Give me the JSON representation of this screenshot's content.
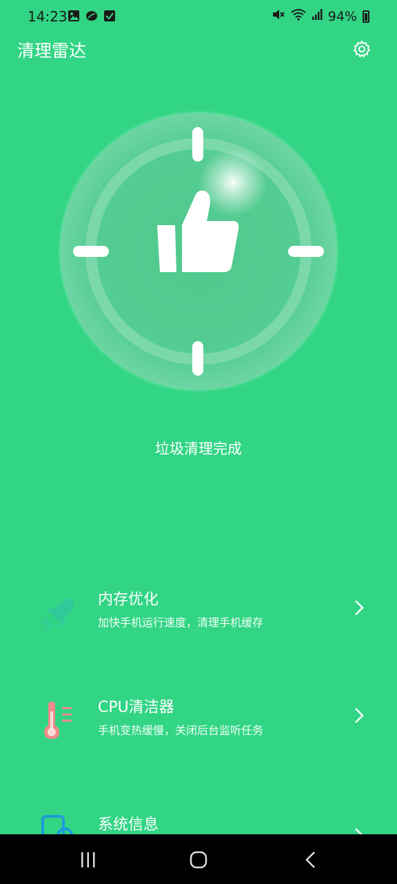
{
  "status_bar": {
    "time": "14:23",
    "battery": "94%",
    "left_icons": [
      "gallery-icon",
      "leaf-icon",
      "check-box-icon"
    ],
    "right_icons": [
      "mute-icon",
      "wifi-icon",
      "signal-icon",
      "battery-icon"
    ]
  },
  "header": {
    "title": "清理雷达",
    "settings_icon": "gear-icon"
  },
  "radar": {
    "center_icon": "thumbs-up-icon",
    "status_text": "垃圾清理完成"
  },
  "features": [
    {
      "title": "内存优化",
      "desc": "加快手机运行速度，清理手机缓存",
      "icon": "rocket-icon"
    },
    {
      "title": "CPU清洁器",
      "desc": "手机变热缓慢，关闭后台监听任务",
      "icon": "thermometer-icon"
    },
    {
      "title": "系统信息",
      "desc": "",
      "icon": "phone-search-icon"
    }
  ],
  "colors": {
    "background": "#31d584",
    "rocket": "#2fc7a0",
    "thermometer": "#f08a8a",
    "system_info": "#1e9bd8"
  },
  "nav_bar": [
    "recent-apps-icon",
    "home-icon",
    "back-icon"
  ]
}
